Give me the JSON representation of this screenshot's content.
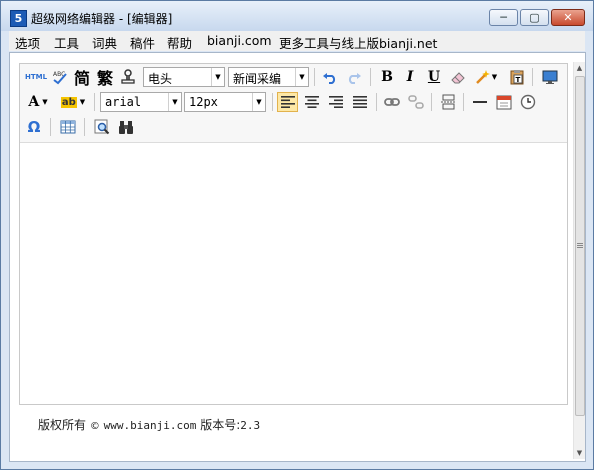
{
  "window": {
    "title": "超级网络编辑器 - [编辑器]",
    "icon_label": "5",
    "controls": {
      "minimize": "─",
      "maximize": "▢",
      "close": "✕"
    }
  },
  "menu": [
    "选项",
    "工具",
    "词典",
    "稿件",
    "帮助",
    "bianji.com",
    "更多工具与线上版bianji.net"
  ],
  "toolbar": {
    "html_label": "HTML",
    "simplified_label": "简",
    "traditional_label": "繁",
    "font_color_label": "A",
    "highlight_label": "ab",
    "bold_label": "B",
    "italic_label": "I",
    "underline_label": "U",
    "omega_label": "Ω",
    "headline_select": "电头",
    "source_select": "新闻采编",
    "font_select": "arial",
    "size_select": "12px"
  },
  "footer": {
    "copyright": "版权所有",
    "copyright_symbol": "©",
    "url": "www.bianji.com",
    "version_label": "版本号:",
    "version": "2.3"
  },
  "colors": {
    "titlebar": "#c7d8ee",
    "close_button": "#c84a2e",
    "active_align": "#fde8a6",
    "link_blue": "#2e6fd1"
  }
}
